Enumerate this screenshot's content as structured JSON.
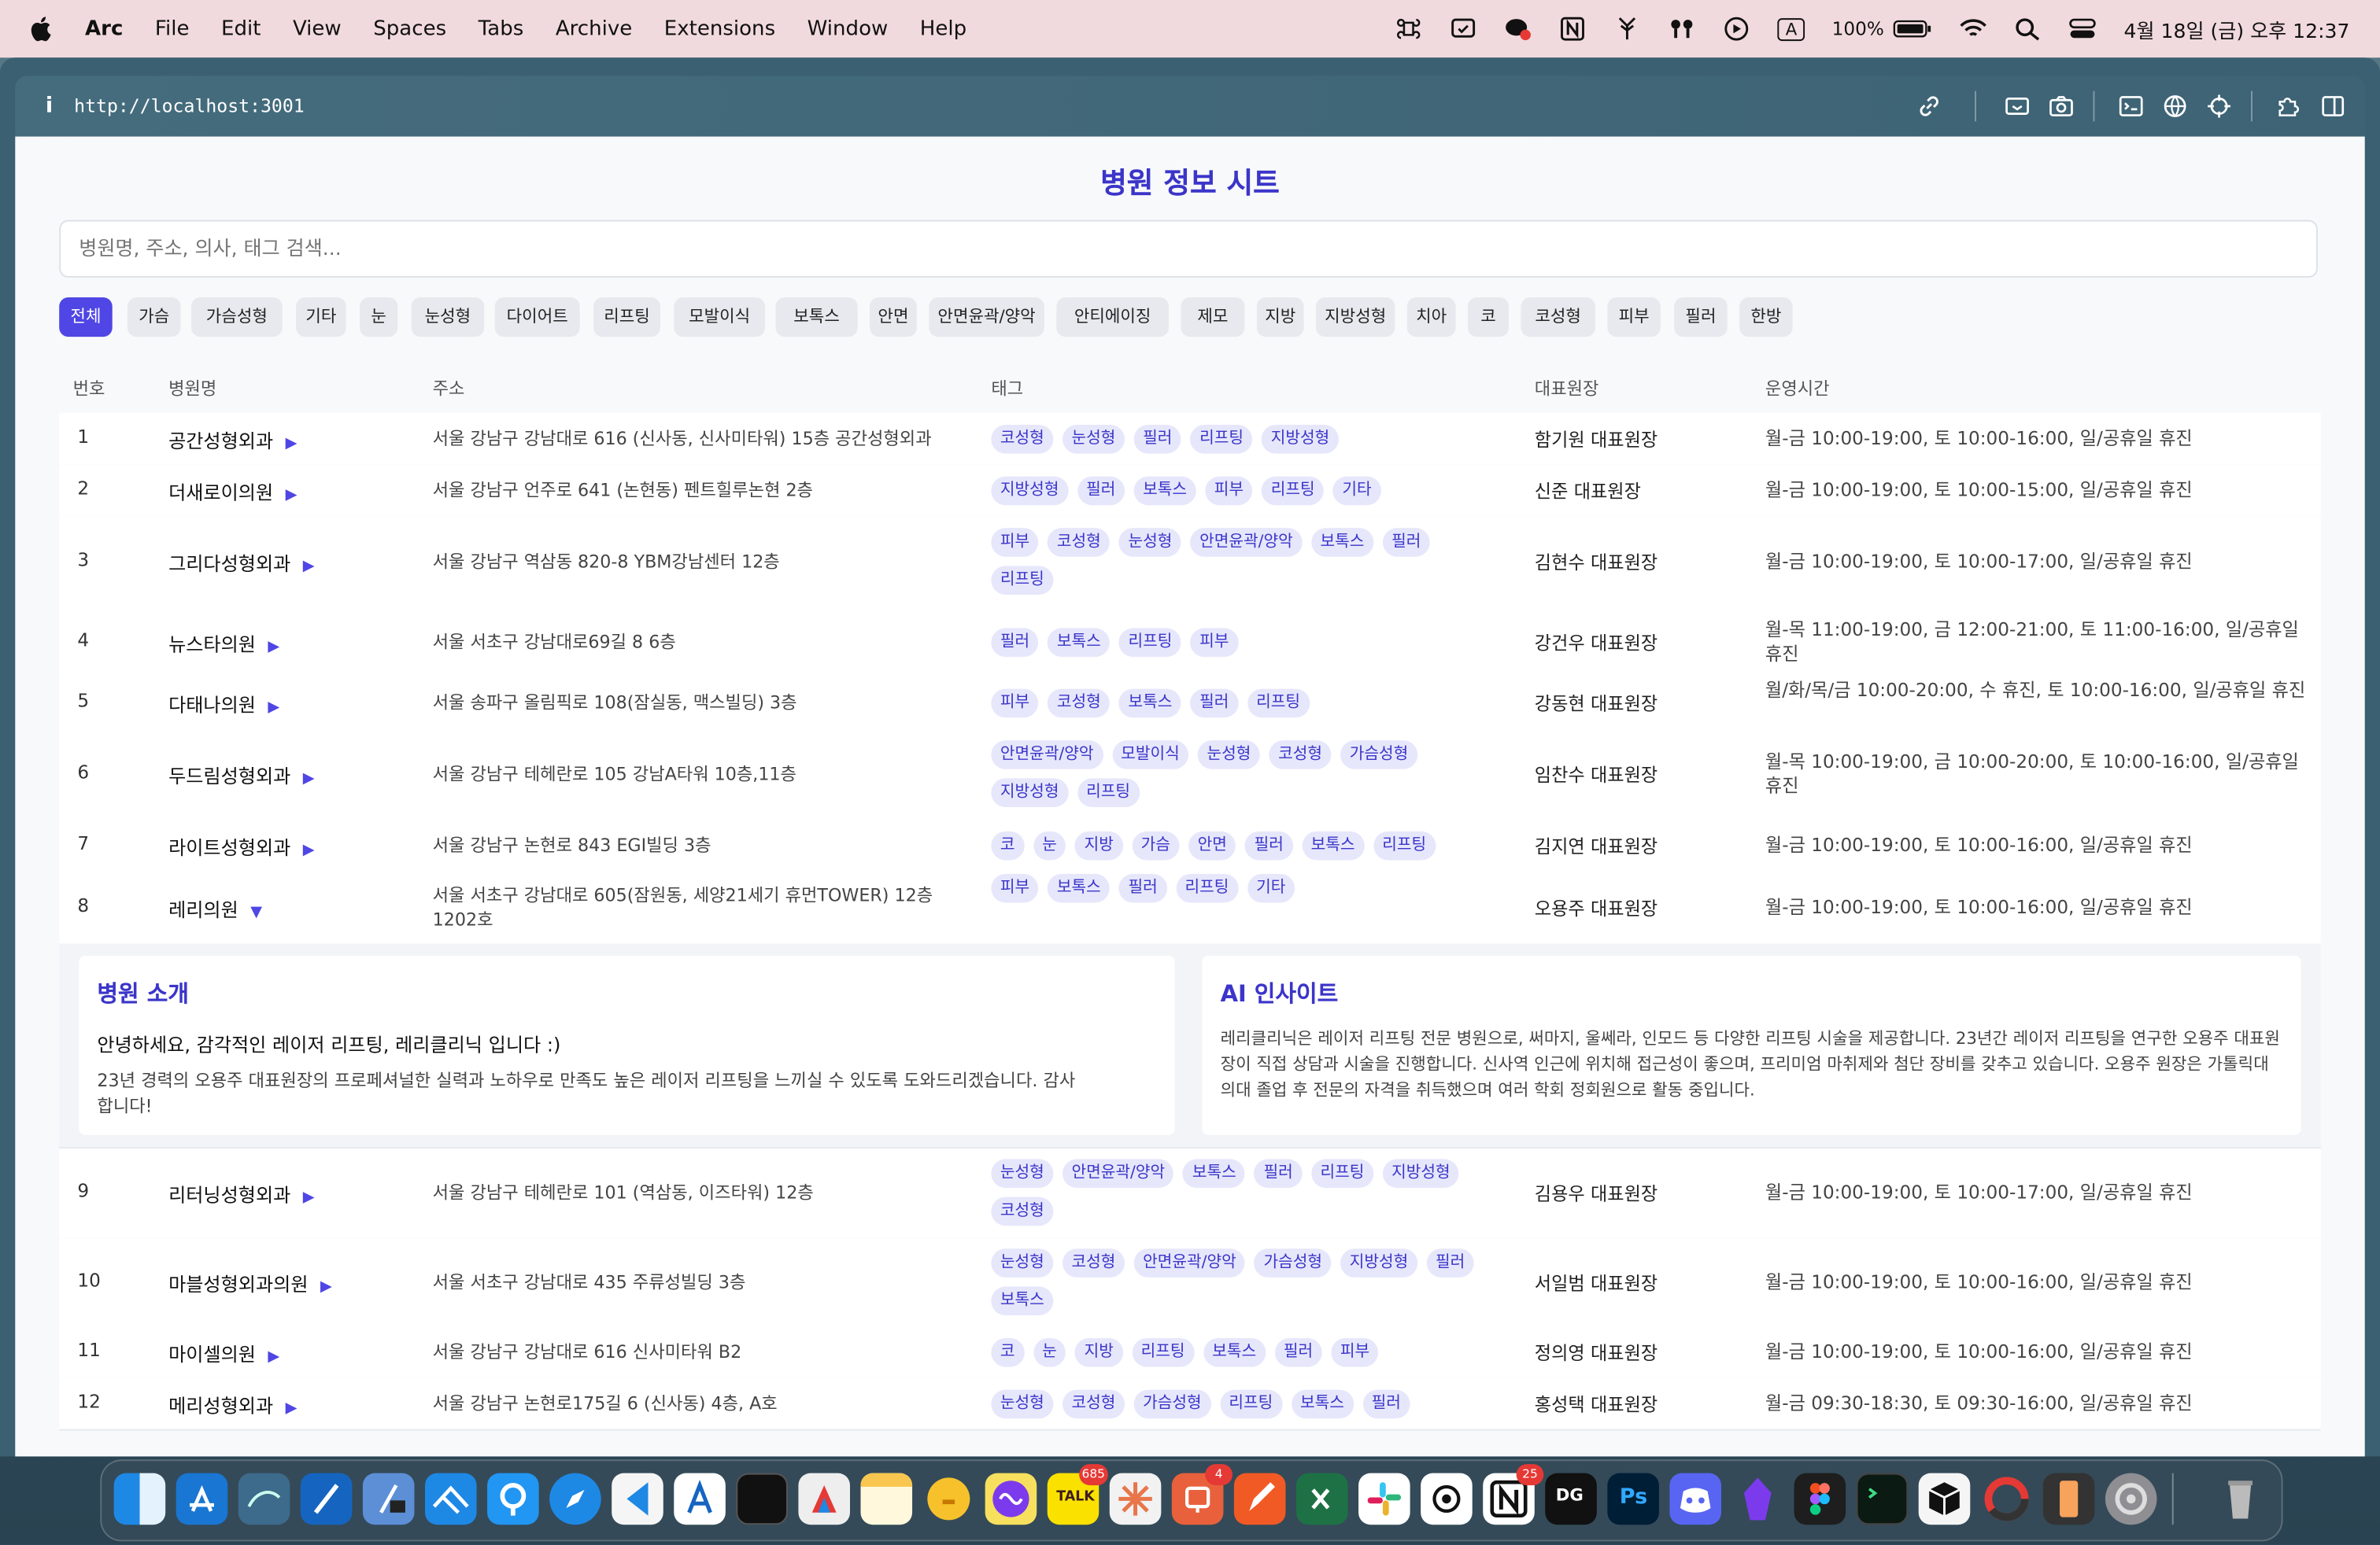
{
  "menubar": {
    "app": "Arc",
    "items": [
      "File",
      "Edit",
      "View",
      "Spaces",
      "Tabs",
      "Archive",
      "Extensions",
      "Window",
      "Help"
    ],
    "battery": "100%",
    "clock": "4월 18일 (금) 오후 12:37",
    "input_indicator": "A"
  },
  "browser": {
    "info_icon": "i",
    "url": "http://localhost:3001"
  },
  "page": {
    "title": "병원 정보 시트",
    "search_placeholder": "병원명, 주소, 의사, 태그 검색...",
    "filters": [
      "전체",
      "가슴",
      "가슴성형",
      "기타",
      "눈",
      "눈성형",
      "다이어트",
      "리프팅",
      "모발이식",
      "보톡스",
      "안면",
      "안면윤곽/양악",
      "안티에이징",
      "제모",
      "지방",
      "지방성형",
      "치아",
      "코",
      "코성형",
      "피부",
      "필러",
      "한방"
    ],
    "active_filter": "전체",
    "columns": [
      "번호",
      "병원명",
      "주소",
      "태그",
      "대표원장",
      "운영시간"
    ]
  },
  "rows": [
    {
      "num": "1",
      "name": "공간성형외과",
      "arrow": "▶",
      "address": "서울 강남구 강남대로 616 (신사동, 신사미타워) 15층 공간성형외과",
      "tags": [
        "코성형",
        "눈성형",
        "필러",
        "리프팅",
        "지방성형"
      ],
      "director": "함기원 대표원장",
      "hours": "월-금 10:00-19:00, 토 10:00-16:00, 일/공휴일 휴진"
    },
    {
      "num": "2",
      "name": "더새로이의원",
      "arrow": "▶",
      "address": "서울 강남구 언주로 641 (논현동) 펜트힐루논현 2층",
      "tags": [
        "지방성형",
        "필러",
        "보톡스",
        "피부",
        "리프팅",
        "기타"
      ],
      "director": "신준 대표원장",
      "hours": "월-금 10:00-19:00, 토 10:00-15:00, 일/공휴일 휴진"
    },
    {
      "num": "3",
      "name": "그리다성형외과",
      "arrow": "▶",
      "address": "서울 강남구 역삼동 820-8 YBM강남센터 12층",
      "tags": [
        "피부",
        "코성형",
        "눈성형",
        "안면윤곽/양악",
        "보톡스",
        "필러",
        "리프팅"
      ],
      "director": "김현수 대표원장",
      "hours": "월-금 10:00-19:00, 토 10:00-17:00, 일/공휴일 휴진"
    },
    {
      "num": "4",
      "name": "뉴스타의원",
      "arrow": "▶",
      "address": "서울 서초구 강남대로69길 8 6층",
      "tags": [
        "필러",
        "보톡스",
        "리프팅",
        "피부"
      ],
      "director": "강건우 대표원장",
      "hours": "월-목 11:00-19:00, 금 12:00-21:00, 토 11:00-16:00, 일/공휴일 휴진"
    },
    {
      "num": "5",
      "name": "다태나의원",
      "arrow": "▶",
      "address": "서울 송파구 올림픽로 108(잠실동, 맥스빌딩) 3층",
      "tags": [
        "피부",
        "코성형",
        "보톡스",
        "필러",
        "리프팅"
      ],
      "director": "강동현 대표원장",
      "hours": "월/화/목/금 10:00-20:00, 수 휴진, 토 10:00-16:00, 일/공휴일 휴진"
    },
    {
      "num": "6",
      "name": "두드림성형외과",
      "arrow": "▶",
      "address": "서울 강남구 테헤란로 105 강남A타워 10층,11층",
      "tags": [
        "안면윤곽/양악",
        "모발이식",
        "눈성형",
        "코성형",
        "가슴성형",
        "지방성형",
        "리프팅"
      ],
      "director": "임찬수 대표원장",
      "hours": "월-목 10:00-19:00, 금 10:00-20:00, 토 10:00-16:00, 일/공휴일 휴진"
    },
    {
      "num": "7",
      "name": "라이트성형외과",
      "arrow": "▶",
      "address": "서울 강남구 논현로 843 EGI빌딩 3층",
      "tags": [
        "코",
        "눈",
        "지방",
        "가슴",
        "안면",
        "필러",
        "보톡스",
        "리프팅"
      ],
      "director": "김지연 대표원장",
      "hours": "월-금 10:00-19:00, 토 10:00-16:00, 일/공휴일 휴진"
    },
    {
      "num": "8",
      "name": "레리의원",
      "arrow": "▼",
      "address": "서울 서초구 강남대로 605(잠원동, 세양21세기 휴먼TOWER) 12층 1202호",
      "tags": [
        "피부",
        "보톡스",
        "필러",
        "리프팅",
        "기타"
      ],
      "director": "오용주 대표원장",
      "hours": "월-금 10:00-19:00, 토 10:00-16:00, 일/공휴일 휴진"
    },
    {
      "num": "9",
      "name": "리터닝성형외과",
      "arrow": "▶",
      "address": "서울 강남구 테헤란로 101 (역삼동, 이즈타워) 12층",
      "tags": [
        "눈성형",
        "안면윤곽/양악",
        "보톡스",
        "필러",
        "리프팅",
        "지방성형",
        "코성형"
      ],
      "director": "김용우 대표원장",
      "hours": "월-금 10:00-19:00, 토 10:00-17:00, 일/공휴일 휴진"
    },
    {
      "num": "10",
      "name": "마블성형외과의원",
      "arrow": "▶",
      "address": "서울 서초구 강남대로 435 주류성빌딩 3층",
      "tags": [
        "눈성형",
        "코성형",
        "안면윤곽/양악",
        "가슴성형",
        "지방성형",
        "필러",
        "보톡스"
      ],
      "director": "서일범 대표원장",
      "hours": "월-금 10:00-19:00, 토 10:00-16:00, 일/공휴일 휴진"
    },
    {
      "num": "11",
      "name": "마이셀의원",
      "arrow": "▶",
      "address": "서울 강남구 강남대로 616 신사미타워 B2",
      "tags": [
        "코",
        "눈",
        "지방",
        "리프팅",
        "보톡스",
        "필러",
        "피부"
      ],
      "director": "정의영 대표원장",
      "hours": "월-금 10:00-19:00, 토 10:00-16:00, 일/공휴일 휴진"
    },
    {
      "num": "12",
      "name": "메리성형외과",
      "arrow": "▶",
      "address": "서울 강남구 논현로175길 6 (신사동) 4층, A호",
      "tags": [
        "눈성형",
        "코성형",
        "가슴성형",
        "리프팅",
        "보톡스",
        "필러"
      ],
      "director": "홍성택 대표원장",
      "hours": "월-금 09:30-18:30, 토 09:30-16:00, 일/공휴일 휴진"
    }
  ],
  "detail": {
    "intro_title": "병원 소개",
    "intro_lead": "안녕하세요, 감각적인 레이저 리프팅, 레리클리닉 입니다 :)",
    "intro_body": "23년 경력의 오용주 대표원장의 프로페셔널한 실력과 노하우로 만족도 높은 레이저 리프팅을 느끼실 수 있도록 도와드리겠습니다. 감사합니다!",
    "ai_title": "AI 인사이트",
    "ai_body": "레리클리닉은 레이저 리프팅 전문 병원으로, 써마지, 울쎄라, 인모드 등 다양한 리프팅 시술을 제공합니다. 23년간 레이저 리프팅을 연구한 오용주 대표원장이 직접 상담과 시술을 진행합니다. 신사역 인근에 위치해 접근성이 좋으며, 프리미엄 마취제와 첨단 장비를 갖추고 있습니다. 오용주 원장은 가톨릭대 의대 졸업 후 전문의 자격을 취득했으며 여러 학회 정회원으로 활동 중입니다."
  },
  "dock": {
    "badges": {
      "talk": "685",
      "todo": "4",
      "notion": "25"
    },
    "talk_label": "TALK",
    "dg_label": "DG",
    "ps_label": "Ps"
  },
  "colors": {
    "accent": "#4f46e5",
    "title": "#3b35c9",
    "tag_bg": "#e6e7fb",
    "menubar": "#f1dadd"
  }
}
